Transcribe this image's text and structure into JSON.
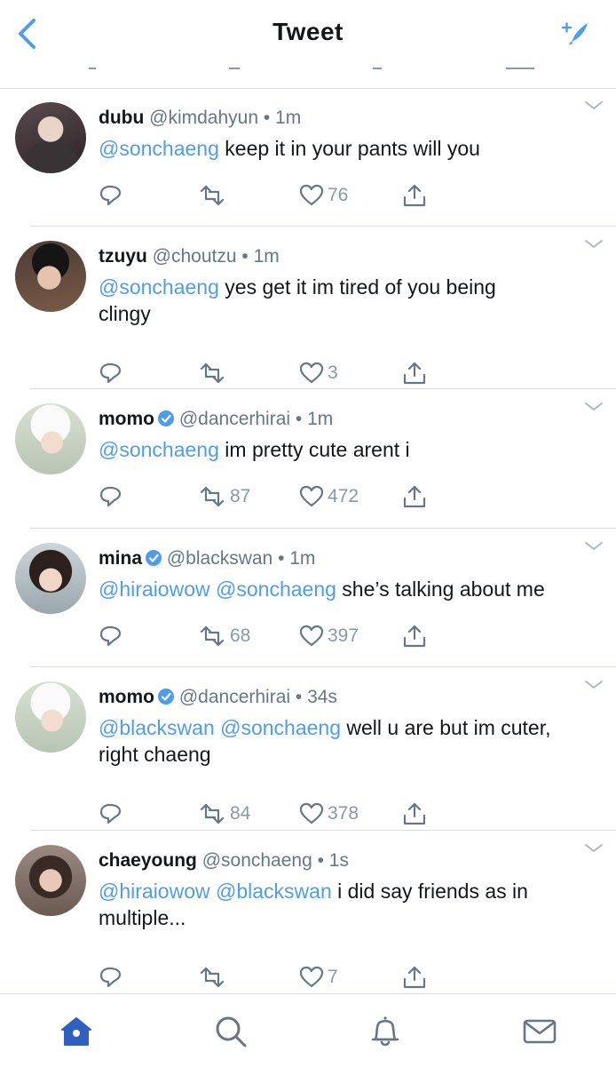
{
  "header": {
    "title": "Tweet",
    "back_icon": "chevron-left-icon",
    "compose_icon": "compose-sparkle-icon",
    "accent": "#4f9de8"
  },
  "tweets": [
    {
      "name": "dubu",
      "verified": false,
      "handle": "@kimdahyun",
      "dot": "•",
      "time": "1m",
      "mentions": [
        "@sonchaeng"
      ],
      "text": " keep it in your pants will you",
      "text2": "",
      "retweets": "",
      "likes": "76"
    },
    {
      "name": "tzuyu",
      "verified": false,
      "handle": "@choutzu",
      "dot": "•",
      "time": "1m",
      "mentions": [
        "@sonchaeng"
      ],
      "text": " yes get it im tired of you being",
      "text2": "clingy",
      "retweets": "",
      "likes": "3"
    },
    {
      "name": "momo",
      "verified": true,
      "handle": "@dancerhirai",
      "dot": "•",
      "time": "1m",
      "mentions": [
        "@sonchaeng"
      ],
      "text": " im pretty cute arent i",
      "text2": "",
      "retweets": "87",
      "likes": "472"
    },
    {
      "name": "mina",
      "verified": true,
      "handle": "@blackswan",
      "dot": "•",
      "time": "1m",
      "mentions": [
        "@hiraiowow",
        "@sonchaeng"
      ],
      "text": " she’s talking about me",
      "text2": "",
      "retweets": "68",
      "likes": "397"
    },
    {
      "name": "momo",
      "verified": true,
      "handle": "@dancerhirai",
      "dot": "•",
      "time": "34s",
      "mentions": [
        "@blackswan",
        "@sonchaeng"
      ],
      "text": " well u are but im cuter,",
      "text2": "right chaeng",
      "retweets": "84",
      "likes": "378"
    },
    {
      "name": "chaeyoung",
      "verified": false,
      "handle": "@sonchaeng",
      "dot": "•",
      "time": "1s",
      "mentions": [
        "@hiraiowow",
        "@blackswan"
      ],
      "text": " i did say friends as in",
      "text2": "multiple...",
      "retweets": "",
      "likes": "7"
    }
  ],
  "tabbar": {
    "items": [
      "home-icon",
      "search-icon",
      "notifications-icon",
      "messages-icon"
    ],
    "active": "home-icon"
  }
}
